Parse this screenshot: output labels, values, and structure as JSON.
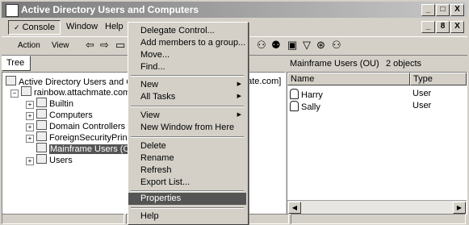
{
  "window": {
    "title": "Active Directory Users and Computers",
    "controls": [
      "_",
      "□",
      "X"
    ],
    "mdi_controls": [
      "_",
      "8",
      "X"
    ]
  },
  "menubar": {
    "items": [
      "Console",
      "Window",
      "Help"
    ]
  },
  "toolbar": {
    "action_label": "Action",
    "view_label": "View"
  },
  "tree": {
    "tab_label": "Tree",
    "root": "Active Directory Users and Com",
    "root_tail": "nate.com]",
    "domain": "rainbow.attachmate.com",
    "children": [
      "Builtin",
      "Computers",
      "Domain Controllers",
      "ForeignSecurityPrincipal",
      "Mainframe Users (OU)",
      "Users"
    ]
  },
  "context_menu": {
    "items": [
      {
        "label": "Delegate Control...",
        "submenu": false
      },
      {
        "label": "Add members to a group...",
        "submenu": false
      },
      {
        "label": "Move...",
        "submenu": false
      },
      {
        "label": "Find...",
        "submenu": false
      },
      {
        "label": "New",
        "submenu": true
      },
      {
        "label": "All Tasks",
        "submenu": true
      },
      {
        "label": "View",
        "submenu": true
      },
      {
        "label": "New Window from Here",
        "submenu": false
      },
      {
        "label": "Delete",
        "submenu": false
      },
      {
        "label": "Rename",
        "submenu": false
      },
      {
        "label": "Refresh",
        "submenu": false
      },
      {
        "label": "Export List...",
        "submenu": false
      },
      {
        "label": "Properties",
        "submenu": false,
        "highlighted": true
      },
      {
        "label": "Help",
        "submenu": false
      }
    ]
  },
  "details": {
    "header_title": "Mainframe Users (OU)",
    "object_count": "2 objects",
    "columns": [
      "Name",
      "Type"
    ],
    "rows": [
      {
        "name": "Harry",
        "type": "User"
      },
      {
        "name": "Sally",
        "type": "User"
      }
    ]
  }
}
